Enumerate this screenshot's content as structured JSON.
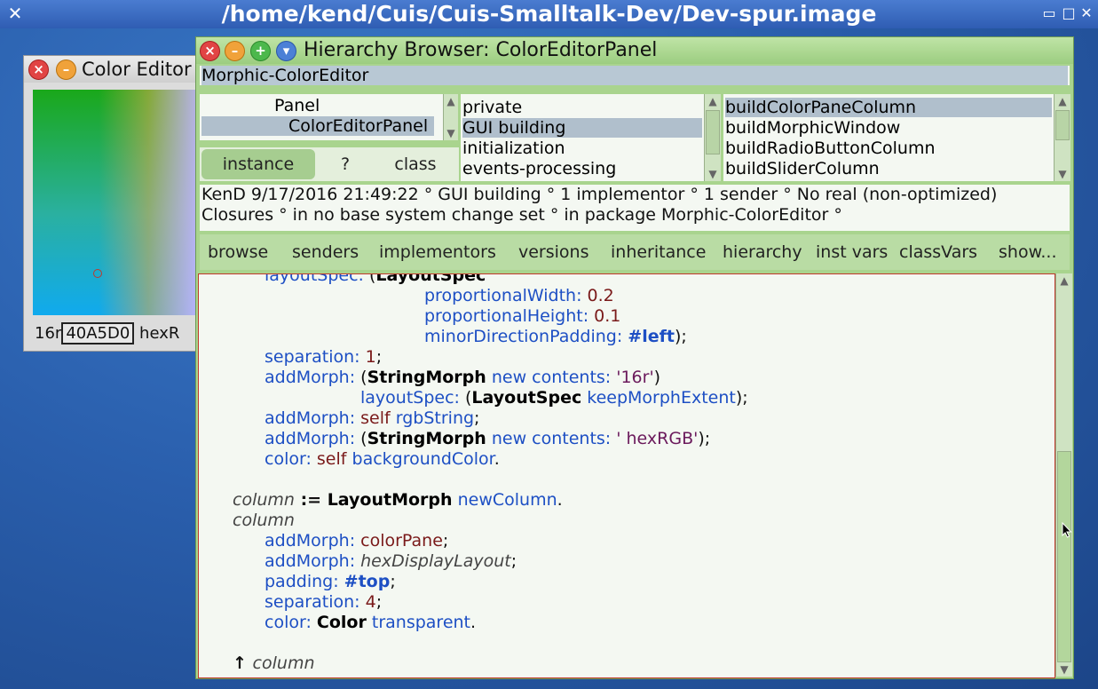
{
  "os_window": {
    "title": "/home/kend/Cuis/Cuis-Smalltalk-Dev/Dev-spur.image"
  },
  "color_editor": {
    "title": "Color Editor",
    "hex_prefix": "16r",
    "hex_value": "40A5D0",
    "hex_suffix": "hexR"
  },
  "browser": {
    "title": "Hierarchy Browser: ColorEditorPanel",
    "class_line": "Morphic-ColorEditor",
    "classes": [
      "Panel",
      "ColorEditorPanel"
    ],
    "selected_class": "ColorEditorPanel",
    "switches": {
      "instance": "instance",
      "help": "?",
      "class": "class"
    },
    "categories": [
      "private",
      "GUI building",
      "initialization",
      "events-processing"
    ],
    "selected_category": "GUI building",
    "methods": [
      "buildColorPaneColumn",
      "buildMorphicWindow",
      "buildRadioButtonColumn",
      "buildSliderColumn"
    ],
    "selected_method": "buildColorPaneColumn",
    "info_line1": "KenD 9/17/2016 21:49:22 ° GUI building ° 1 implementor ° 1 sender ° No real (non-optimized)",
    "info_line2": "Closures ° in no base system change set ° in package Morphic-ColorEditor °",
    "buttons": [
      "browse",
      "senders",
      "implementors",
      "versions",
      "inheritance",
      "hierarchy",
      "inst vars",
      "classVars",
      "show..."
    ]
  },
  "code": {
    "l1_kw": "layoutSpec: ",
    "l1_pl": "(",
    "l1_cls": "LayoutSpec",
    "l2_kw": "proportionalWidth: ",
    "l2_lit": "0.2",
    "l3_kw": "proportionalHeight: ",
    "l3_lit": "0.1",
    "l4_kw": "minorDirectionPadding: ",
    "l4_sym": "#left",
    "l4_pl": ");",
    "l5_kw": "separation: ",
    "l5_lit": "1",
    "l5_pl": ";",
    "l6_kw": "addMorph: ",
    "l6_pl": "(",
    "l6_cls": "StringMorph",
    "l6_kw2": " new contents: ",
    "l6_str": "'16r'",
    "l6_pl2": ")",
    "l7_kw": "layoutSpec: ",
    "l7_pl": "(",
    "l7_cls": "LayoutSpec",
    "l7_kw2": " keepMorphExtent",
    "l7_pl2": ");",
    "l8_kw": "addMorph: ",
    "l8_lit": "self",
    "l8_kw2": " rgbString",
    "l8_pl": ";",
    "l9_kw": "addMorph: ",
    "l9_pl": "(",
    "l9_cls": "StringMorph",
    "l9_kw2": " new contents: ",
    "l9_str": "' hexRGB'",
    "l9_pl2": ");",
    "l10_kw": "color: ",
    "l10_lit": "self",
    "l10_kw2": " backgroundColor",
    "l10_pl": ".",
    "l11_tmp": "column",
    "l11_pl": " := ",
    "l11_cls": "LayoutMorph",
    "l11_kw": " newColumn",
    "l11_pl2": ".",
    "l12_tmp": "column",
    "l13_kw": "addMorph: ",
    "l13_lit": "colorPane",
    "l13_pl": ";",
    "l14_kw": "addMorph: ",
    "l14_tmp": "hexDisplayLayout",
    "l14_pl": ";",
    "l15_kw": "padding: ",
    "l15_sym": "#top",
    "l15_pl": ";",
    "l16_kw": "separation: ",
    "l16_lit": "4",
    "l16_pl": ";",
    "l17_kw": "color: ",
    "l17_cls": "Color",
    "l17_kw2": " transparent",
    "l17_pl": ".",
    "l18_pl": "↑ ",
    "l18_tmp": "column"
  }
}
